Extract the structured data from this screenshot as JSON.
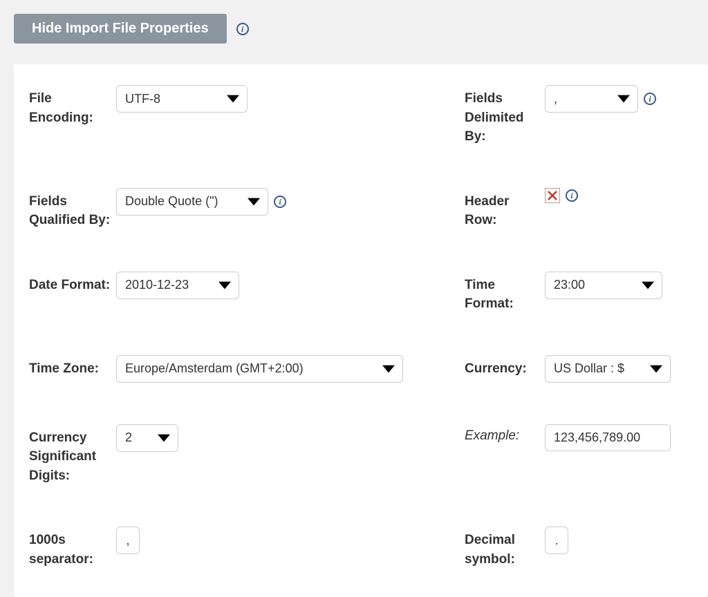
{
  "header": {
    "toggle_label": "Hide Import File Properties"
  },
  "fields": {
    "file_encoding": {
      "label": "File Encoding:",
      "value": "UTF-8"
    },
    "fields_delimited_by": {
      "label": "Fields Delimited By:",
      "value": ","
    },
    "fields_qualified_by": {
      "label": "Fields Qualified By:",
      "value": "Double Quote (\")"
    },
    "header_row": {
      "label": "Header Row:",
      "checked": false
    },
    "date_format": {
      "label": "Date Format:",
      "value": "2010-12-23"
    },
    "time_format": {
      "label": "Time Format:",
      "value": "23:00"
    },
    "time_zone": {
      "label": "Time Zone:",
      "value": "Europe/Amsterdam (GMT+2:00)"
    },
    "currency": {
      "label": "Currency:",
      "value": "US Dollar : $"
    },
    "currency_digits": {
      "label": "Currency Significant Digits:",
      "value": "2"
    },
    "example": {
      "label": "Example:",
      "value": "123,456,789.00"
    },
    "thousands_sep": {
      "label": "1000s separator:",
      "value": ","
    },
    "decimal_symbol": {
      "label": "Decimal symbol:",
      "value": "."
    }
  },
  "icons": {
    "info_glyph": "i"
  }
}
